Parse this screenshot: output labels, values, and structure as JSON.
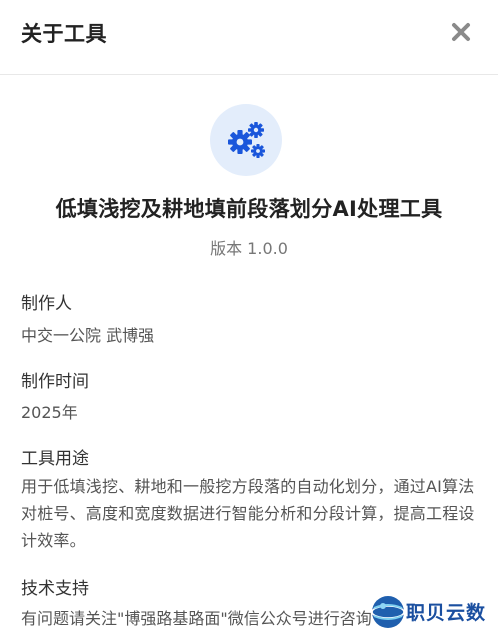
{
  "dialog": {
    "title": "关于工具",
    "close_icon": "close-x-icon"
  },
  "app": {
    "icon": "gears-icon",
    "icon_color": "#1a56db",
    "icon_bg": "#e3edfb",
    "name": "低填浅挖及耕地填前段落划分AI处理工具",
    "version": "版本 1.0.0"
  },
  "sections": {
    "author_label": "制作人",
    "author_value": "中交一公院 武博强",
    "date_label": "制作时间",
    "date_value": "2025年",
    "purpose_label": "工具用途",
    "purpose_value": "用于低填浅挖、耕地和一般挖方段落的自动化划分，通过AI算法对桩号、高度和宽度数据进行智能分析和分段计算，提高工程设计效率。",
    "support_label": "技术支持",
    "support_value": "有问题请关注\"博强路基路面\"微信公众号进行咨询"
  },
  "watermark": {
    "text": "职贝云数",
    "logo_icon": "globe-logo-icon"
  }
}
